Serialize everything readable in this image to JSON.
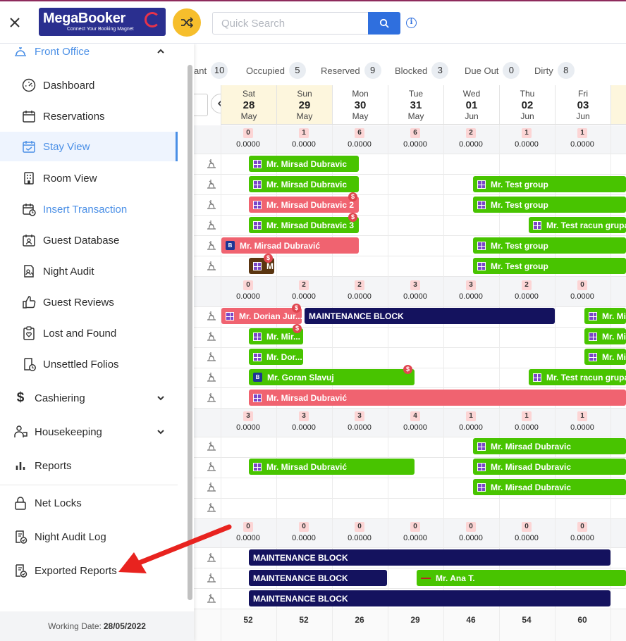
{
  "header": {
    "close_icon": "close-icon",
    "logo_text": "MegaBooker",
    "logo_tagline": "Connect Your Booking Magnet",
    "search_placeholder": "Quick Search"
  },
  "sidebar": {
    "front_office": "Front Office",
    "items": [
      {
        "label": "Dashboard",
        "icon": "gauge-icon"
      },
      {
        "label": "Reservations",
        "icon": "calendar-icon"
      },
      {
        "label": "Stay View",
        "icon": "calendar-check-icon",
        "active": true
      },
      {
        "label": "Room View",
        "icon": "building-icon"
      },
      {
        "label": "Insert Transaction",
        "icon": "calendar-clock-icon"
      },
      {
        "label": "Guest Database",
        "icon": "guest-card-icon"
      },
      {
        "label": "Night Audit",
        "icon": "audit-icon"
      },
      {
        "label": "Guest Reviews",
        "icon": "thumbs-up-icon"
      },
      {
        "label": "Lost and Found",
        "icon": "clipboard-heart-icon"
      },
      {
        "label": "Unsettled Folios",
        "icon": "folio-clock-icon"
      }
    ],
    "cashiering": "Cashiering",
    "housekeeping": "Housekeeping",
    "reports": "Reports",
    "net_locks": "Net Locks",
    "night_audit_log": "Night Audit Log",
    "exported_reports": "Exported Reports",
    "working_date_label": "Working Date:",
    "working_date_value": "28/05/2022"
  },
  "stats": [
    {
      "label": "ant",
      "count": "10"
    },
    {
      "label": "Occupied",
      "count": "5"
    },
    {
      "label": "Reserved",
      "count": "9"
    },
    {
      "label": "Blocked",
      "count": "3"
    },
    {
      "label": "Due Out",
      "count": "0"
    },
    {
      "label": "Dirty",
      "count": "8"
    }
  ],
  "days": [
    {
      "dow": "Sat",
      "day": "28",
      "mon": "May"
    },
    {
      "dow": "Sun",
      "day": "29",
      "mon": "May"
    },
    {
      "dow": "Mon",
      "day": "30",
      "mon": "May"
    },
    {
      "dow": "Tue",
      "day": "31",
      "mon": "May"
    },
    {
      "dow": "Wed",
      "day": "01",
      "mon": "Jun"
    },
    {
      "dow": "Thu",
      "day": "02",
      "mon": "Jun"
    },
    {
      "dow": "Fri",
      "day": "03",
      "mon": "Jun"
    }
  ],
  "summaries": [
    {
      "counts": [
        "0",
        "1",
        "6",
        "6",
        "2",
        "1",
        "1"
      ],
      "amounts": [
        "0.0000",
        "0.0000",
        "0.0000",
        "0.0000",
        "0.0000",
        "0.0000",
        "0.0000"
      ]
    },
    {
      "counts": [
        "0",
        "2",
        "2",
        "3",
        "3",
        "2",
        "0"
      ],
      "amounts": [
        "0.0000",
        "0.0000",
        "0.0000",
        "0.0000",
        "0.0000",
        "0.0000",
        "0.0000"
      ]
    },
    {
      "counts": [
        "3",
        "3",
        "3",
        "4",
        "1",
        "1",
        "1"
      ],
      "amounts": [
        "0.0000",
        "0.0000",
        "0.0000",
        "0.0000",
        "0.0000",
        "0.0000",
        "0.0000"
      ]
    },
    {
      "counts": [
        "0",
        "0",
        "0",
        "0",
        "0",
        "0",
        "0"
      ],
      "amounts": [
        "0.0000",
        "0.0000",
        "0.0000",
        "0.0000",
        "0.0000",
        "0.0000",
        "0.0000"
      ]
    }
  ],
  "bookings": [
    {
      "label": "Mr. Mirsad Dubravic"
    },
    {
      "label": "Mr. Mirsad Dubravic"
    },
    {
      "label": "Mr. Test group"
    },
    {
      "label": "Mr. Mirsad Dubravic 2"
    },
    {
      "label": "Mr. Test group"
    },
    {
      "label": "Mr. Mirsad Dubravic 3"
    },
    {
      "label": "Mr. Test racun grupa"
    },
    {
      "label": "Mr. Mirsad Dubravić"
    },
    {
      "label": "Mr. Test group"
    },
    {
      "label": "M"
    },
    {
      "label": "Mr. Test group"
    },
    {
      "label": "Mr. Dorian Jur..."
    },
    {
      "label": "MAINTENANCE BLOCK"
    },
    {
      "label": "Mr. Mi"
    },
    {
      "label": "Mr. Mir..."
    },
    {
      "label": "Mr. Mi"
    },
    {
      "label": "Mr. Dor..."
    },
    {
      "label": "Mr. Mi"
    },
    {
      "label": "Mr. Goran Slavuj"
    },
    {
      "label": "Mr. Test racun grupa"
    },
    {
      "label": "Mr. Mirsad Dubravić"
    },
    {
      "label": "Mr. Mirsad Dubravic"
    },
    {
      "label": "Mr. Mirsad Dubravić"
    },
    {
      "label": "Mr. Mirsad Dubravic"
    },
    {
      "label": "Mr. Mirsad Dubravic"
    },
    {
      "label": "MAINTENANCE BLOCK"
    },
    {
      "label": "MAINTENANCE BLOCK"
    },
    {
      "label": "Mr. Ana T."
    },
    {
      "label": "MAINTENANCE BLOCK"
    }
  ],
  "totals": [
    "52",
    "52",
    "26",
    "29",
    "46",
    "54",
    "60"
  ],
  "dollar_badge": "$",
  "bill_badge": "B",
  "colors": {
    "accent": "#4a8fe6",
    "booking_green": "#48c400",
    "booking_red": "#f06370",
    "maintenance": "#14125e",
    "annotation_arrow": "#e8231f"
  }
}
